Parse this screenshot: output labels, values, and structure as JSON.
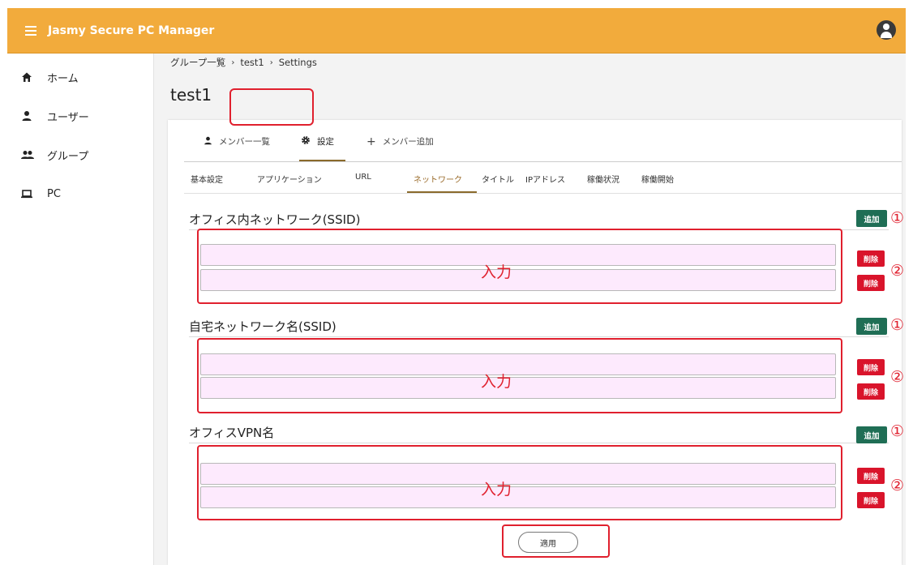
{
  "app": {
    "title": "Jasmy Secure PC Manager"
  },
  "sidebar": {
    "items": [
      {
        "label": "ホーム",
        "icon": "home-icon"
      },
      {
        "label": "ユーザー",
        "icon": "person-icon"
      },
      {
        "label": "グループ",
        "icon": "group-icon"
      },
      {
        "label": "PC",
        "icon": "laptop-icon"
      }
    ]
  },
  "breadcrumb": {
    "root": "グループ一覧",
    "group": "test1",
    "current": "Settings",
    "separator": "›"
  },
  "page": {
    "title": "test1"
  },
  "tabs1": [
    {
      "label": "メンバー一覧",
      "icon": "person-icon"
    },
    {
      "label": "設定",
      "icon": "gear-icon"
    },
    {
      "label": "メンバー追加",
      "icon": "plus-icon"
    }
  ],
  "tabs2": [
    "基本設定",
    "アプリケーション",
    "URL",
    "ネットワーク",
    "タイトル",
    "IPアドレス",
    "稼働状況",
    "稼働開始"
  ],
  "tabs2_active": "ネットワーク",
  "sections": [
    {
      "title": "オフィス内ネットワーク(SSID)",
      "add_label": "追加",
      "delete_label": "削除",
      "input_annotation": "入力",
      "marker_add": "①",
      "marker_delete": "②",
      "fields": [
        "",
        ""
      ]
    },
    {
      "title": "自宅ネットワーク名(SSID)",
      "add_label": "追加",
      "delete_label": "削除",
      "input_annotation": "入力",
      "marker_add": "①",
      "marker_delete": "②",
      "fields": [
        "",
        ""
      ]
    },
    {
      "title": "オフィスVPN名",
      "add_label": "追加",
      "delete_label": "削除",
      "input_annotation": "入力",
      "marker_add": "①",
      "marker_delete": "②",
      "fields": [
        "",
        ""
      ]
    }
  ],
  "apply_label": "適用",
  "colors": {
    "appbar": "#f2ab3c",
    "add_button": "#1f6e55",
    "delete_button": "#d9142b",
    "annotation": "#e0202e",
    "field_bg": "#fdeafd"
  }
}
